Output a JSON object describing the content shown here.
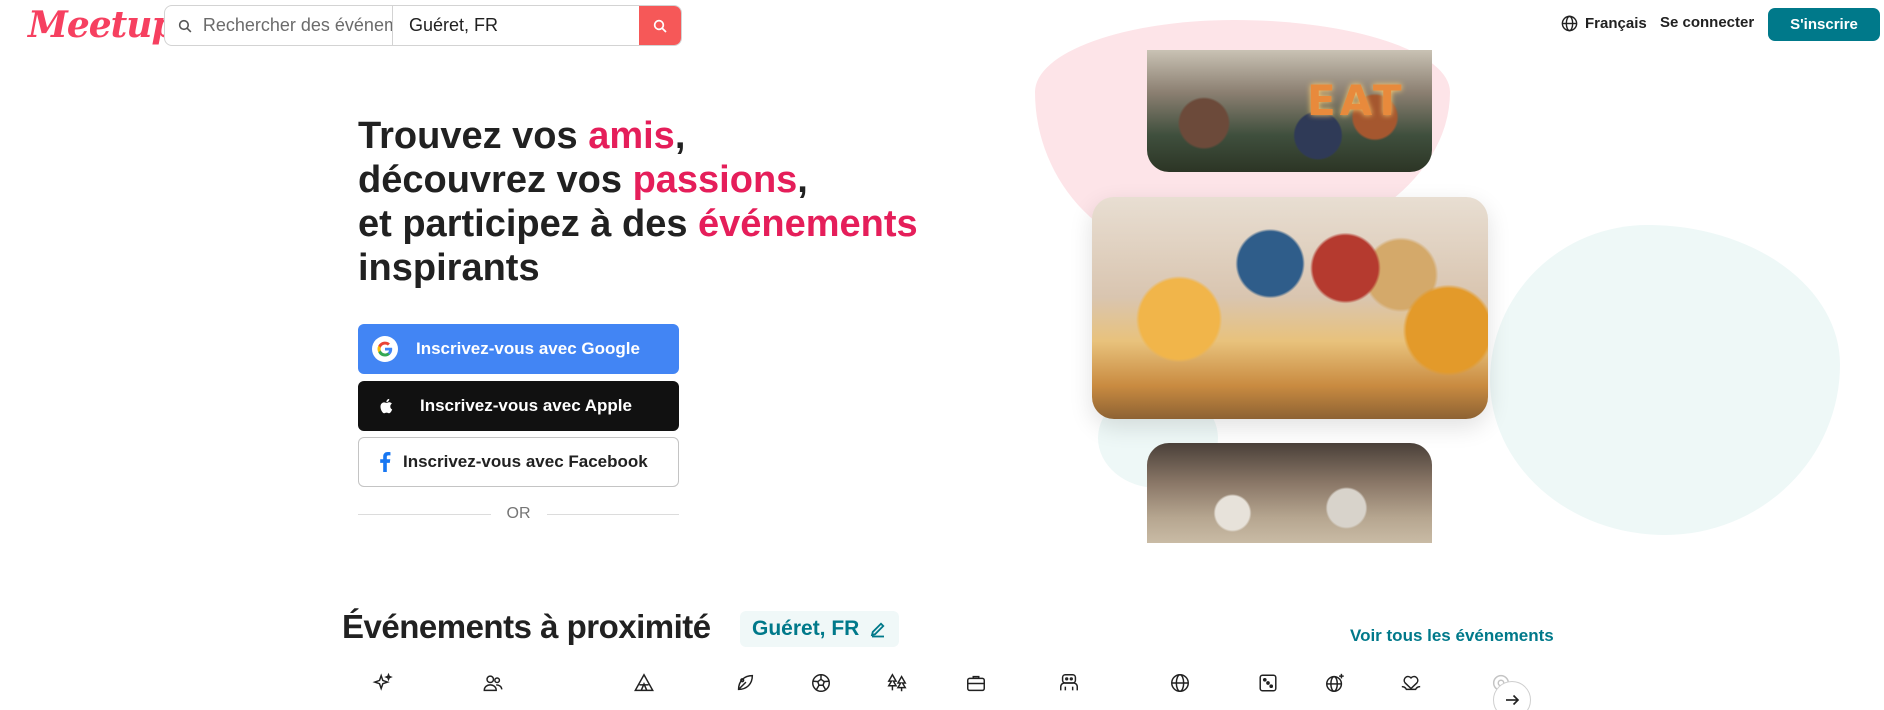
{
  "header": {
    "logo": "Meetup",
    "search": {
      "keyword_placeholder": "Rechercher des événements",
      "location_value": "Guéret, FR"
    },
    "language": "Français",
    "login": "Se connecter",
    "signup": "S'inscrire"
  },
  "hero": {
    "title_parts": [
      {
        "text": "Trouvez vos ",
        "highlight": false
      },
      {
        "text": "amis",
        "highlight": true
      },
      {
        "text": ",",
        "highlight": false
      },
      {
        "text": "découvrez vos ",
        "highlight": false
      },
      {
        "text": "passions",
        "highlight": true
      },
      {
        "text": ",",
        "highlight": false
      },
      {
        "text": "et participez à des ",
        "highlight": false
      },
      {
        "text": "événements",
        "highlight": true
      },
      {
        "text": "inspirants",
        "highlight": false
      }
    ],
    "google_button": "Inscrivez-vous avec Google",
    "apple_button": "Inscrivez-vous avec Apple",
    "facebook_button": "Inscrivez-vous avec Facebook",
    "or_label": "OR",
    "photo_sign": "EAT"
  },
  "events": {
    "title": "Événements à proximité",
    "location": "Guéret, FR",
    "see_all": "Voir tous les événements",
    "categories": [
      {
        "icon": "sparkle-icon"
      },
      {
        "icon": "people-icon"
      },
      {
        "icon": "tent-icon"
      },
      {
        "icon": "leaf-icon"
      },
      {
        "icon": "ball-icon"
      },
      {
        "icon": "trees-icon"
      },
      {
        "icon": "briefcase-icon"
      },
      {
        "icon": "gaming-icon"
      },
      {
        "icon": "globe-icon"
      },
      {
        "icon": "dice-icon"
      },
      {
        "icon": "globe-plus-icon"
      },
      {
        "icon": "heart-hands-icon"
      },
      {
        "icon": "more-icon"
      }
    ]
  },
  "colors": {
    "brand": "#f64060",
    "accent_teal": "#00798a",
    "highlight": "#e51e5a",
    "google_blue": "#4285f4"
  }
}
